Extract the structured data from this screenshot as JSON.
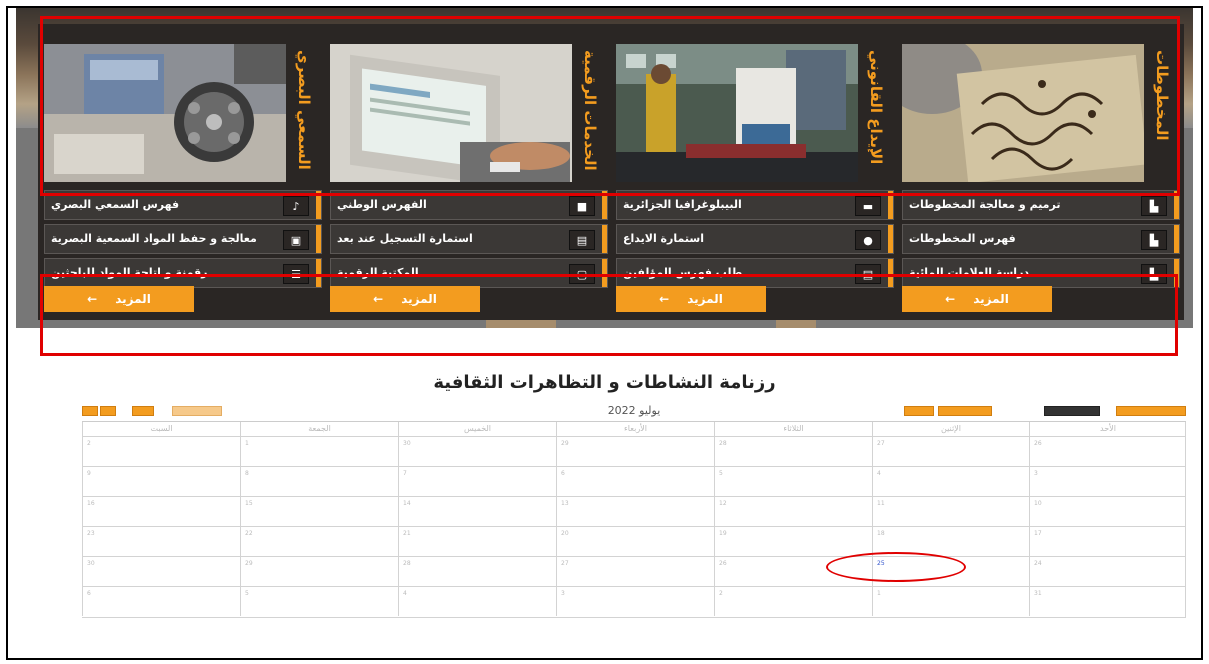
{
  "services": [
    {
      "title": "المخطوطات",
      "items": [
        "ترميم و معالجة المخطوطات",
        "فهرس المخطوطات",
        "دراسة العلامات المائية"
      ],
      "more": "المزيد"
    },
    {
      "title": "الإيداع القانوني",
      "items": [
        "البيبلوغرافيا الجزائرية",
        "استمارة الايداع",
        "طلب فهرس المؤلفين"
      ],
      "more": "المزيد"
    },
    {
      "title": "الخدمات الرقمية",
      "items": [
        "الفهرس الوطني",
        "استمارة التسجيل عند بعد",
        "المكتبة الرقمية"
      ],
      "more": "المزيد"
    },
    {
      "title": "السمعي البصري",
      "items": [
        "فهرس السمعي البصري",
        "معالجة و حفظ المواد السمعية البصرية",
        "رقمنة و اتاحة المواد للباحثين"
      ],
      "more": "المزيد"
    }
  ],
  "calendar": {
    "title": "رزنامة النشاطات و التظاهرات الثقافية",
    "month": "يوليو 2022",
    "days": [
      "الأحد",
      "الإثنين",
      "الثلاثاء",
      "الأربعاء",
      "الخميس",
      "الجمعة",
      "السبت"
    ],
    "weeks": [
      [
        "26",
        "27",
        "28",
        "29",
        "30",
        "1",
        "2"
      ],
      [
        "3",
        "4",
        "5",
        "6",
        "7",
        "8",
        "9"
      ],
      [
        "10",
        "11",
        "12",
        "13",
        "14",
        "15",
        "16"
      ],
      [
        "17",
        "18",
        "19",
        "20",
        "21",
        "22",
        "23"
      ],
      [
        "24",
        "25",
        "26",
        "27",
        "28",
        "29",
        "30"
      ],
      [
        "31",
        "1",
        "2",
        "3",
        "4",
        "5",
        "6"
      ]
    ],
    "today": "25"
  },
  "colors": {
    "accent": "#f39c1f",
    "panel": "#2a2624",
    "annotation": "#e00000"
  }
}
